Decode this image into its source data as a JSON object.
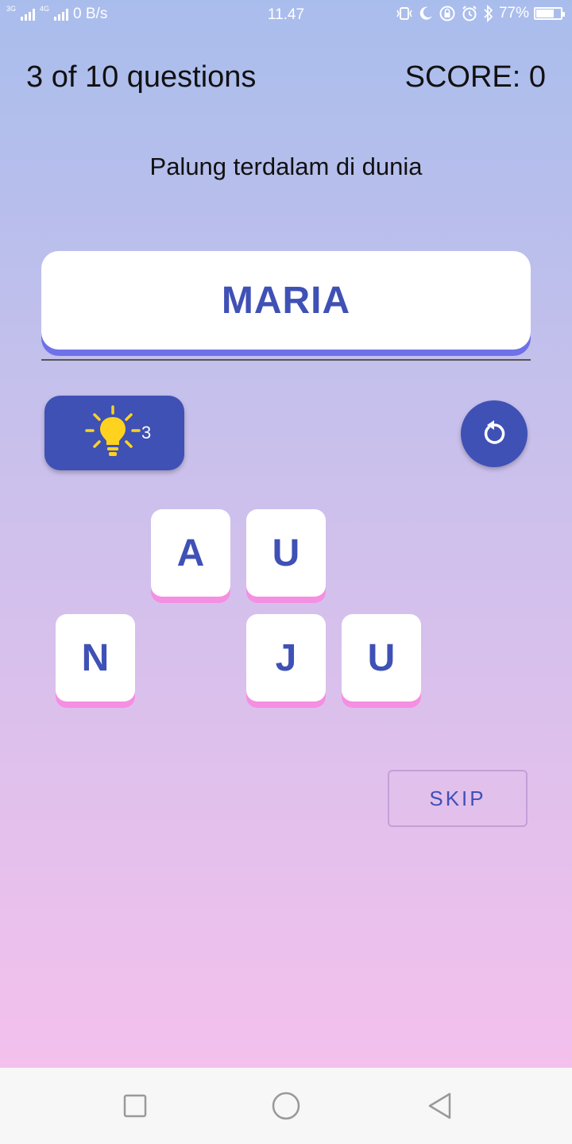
{
  "status_bar": {
    "network_1": "3G",
    "network_2": "4G",
    "speed": "0 B/s",
    "time": "11.47",
    "battery": "77%",
    "battery_level": 0.77,
    "icons": [
      "vibrate-icon",
      "moon-icon",
      "rotation-lock-icon",
      "alarm-icon",
      "bluetooth-icon",
      "battery-icon"
    ]
  },
  "header": {
    "progress": "3 of 10 questions",
    "score": "SCORE: 0"
  },
  "question": "Palung terdalam di dunia",
  "answer": "MARIA",
  "hint": {
    "icon": "lightbulb-icon",
    "count": "3"
  },
  "reset": {
    "icon": "restart-icon"
  },
  "tiles": {
    "row1": [
      "A",
      "U"
    ],
    "row2": [
      "N",
      "J",
      "U"
    ]
  },
  "skip_label": "SKIP",
  "navbar": {
    "icons": [
      "recent-apps-icon",
      "home-icon",
      "back-icon"
    ]
  },
  "colors": {
    "accent": "#3f51b5",
    "tile_shadow": "#f58fe2",
    "answer_shadow": "#6e71e8",
    "bulb": "#ffd21f"
  }
}
